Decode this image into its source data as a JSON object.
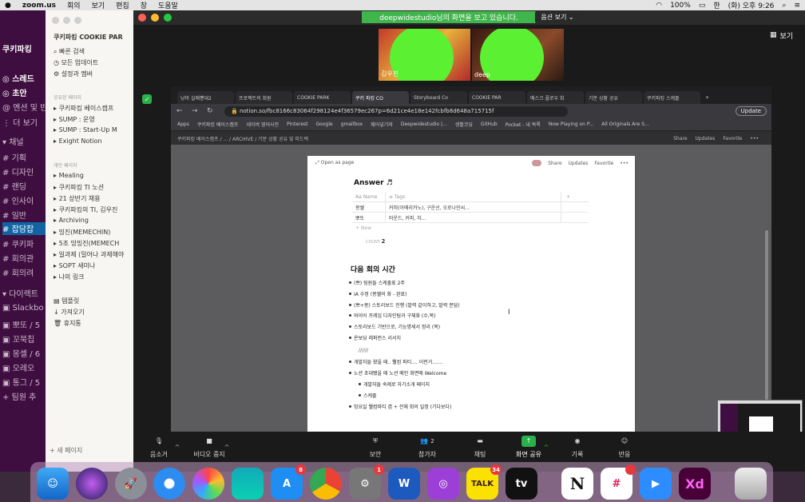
{
  "menubar": {
    "app": "zoom.us",
    "items": [
      "회의",
      "보기",
      "편집",
      "창",
      "도움말"
    ],
    "battery": "100%",
    "clock": "(화) 오후 9:26"
  },
  "slack": {
    "workspace": "쿠키파킹",
    "rows": [
      "스레드",
      "초안",
      "멘션 및 반",
      "더 보기",
      "채널",
      "기획",
      "디자인",
      "랜딩",
      "인사이",
      "일반",
      "잡담잡",
      "쿠키파",
      "회의관",
      "회의려",
      "다이렉트",
      "Slackbo",
      "뽀또 / 5",
      "꼬북칩",
      "몽셀 / 6",
      "오레오",
      "통그 / 5",
      "팀원 추"
    ]
  },
  "notion_sidebar": {
    "workspace": "쿠키파킹 COOKIE PAR",
    "quick": [
      "빠른 검색",
      "모든 업데이트",
      "설정과 멤버"
    ],
    "shared_label": "공유된 페이지",
    "shared": [
      "쿠키파킹 베이스캠프",
      "SUMP : 운영",
      "SUMP : Start-Up M",
      "Exight Notion"
    ],
    "private_label": "개인 페이지",
    "private": [
      "Mealing",
      "쿠키파킹 TI 노션",
      "21 상반기 채용",
      "쿠키파킹의 TI, 김우진",
      "Archiving",
      "밍진(MEMECHIN)",
      "5조 밍밍진(MEMECH",
      "일과제 (밀어나 과제해야",
      "SOPT 세미나",
      "나의 링크"
    ],
    "bottom": [
      "템플릿",
      "가져오기",
      "휴지통"
    ],
    "new_page": "새 페이지"
  },
  "zoom": {
    "banner": "deepwidestudio님의 화면을 보고 있습니다.",
    "view_options": "옵션 보기",
    "view_button": "보기",
    "participants": [
      {
        "name": "김우진"
      },
      {
        "name": "deep"
      }
    ],
    "toolbar": {
      "mute": "음소거",
      "video": "비디오 중지",
      "security": "보안",
      "participants": "참가자",
      "participants_count": "2",
      "chat": "채팅",
      "share": "화면 공유",
      "record": "기록",
      "reactions": "반응"
    }
  },
  "browser": {
    "tabs": [
      "낭미 실매뽕대2",
      "프로젝트의 회원",
      "COOKIE PARK",
      "쿠키 파킹 CO",
      "Storyboard Co",
      "COOKIE PAR",
      "메스크 플로우 회",
      "기분 상황 공유",
      "쿠키파킹 스케줄"
    ],
    "url": "notion.so/fbc8166c83064f298124e4f36579ec267p=6d21ce4e18e142fcbfb8d648a715715f",
    "update": "Update",
    "bookmarks": [
      "Apps",
      "쿠키파킹 베이스캠프",
      "네이버 영어사전",
      "Pinterest",
      "Google",
      "gmailbox",
      "웨어넣기와",
      "Deepwidestudio |...",
      "생활코딩",
      "GitHub",
      "Pocket - 내 목록",
      "Now Playing on P...",
      "All Originals Are S..."
    ],
    "notion_path": "쿠키파킹 베이스캠프  /  ...  /  ARCHIVE  /  기분 상황 공유 및 피드백",
    "notion_actions": [
      "Share",
      "Updates",
      "Favorite",
      "•••"
    ]
  },
  "page": {
    "open_as_page": "Open as page",
    "actions": [
      "Share",
      "Updates",
      "Favorite",
      "•••"
    ],
    "answer_heading": "Answer ♬",
    "table": {
      "headers": [
        "Aa Name",
        "≡ Tags"
      ],
      "rows": [
        [
          "몽쉘",
          "커피(아메리카노), 구운선, 오로나민씨..."
        ],
        [
          "뽀또",
          "마운드, 커피, 차..."
        ]
      ],
      "new_label": "+ New",
      "count_label": "COUNT",
      "count_value": "2"
    },
    "next_heading": "다음 회의 시간",
    "items": [
      "(쁘) 팀원들 스케줄표 2주",
      "IA 수정 (몽쉘의 화 - 완료)",
      "(쁘+몽) 스토리보드 진행 (맡력 같이하고, 맡력 분담)",
      "와이어 프레임 디자인팀과 구체화 (수,목)",
      "스토리보드 기반으로, 기능명세서 정리 (목)",
      "온보딩 레퍼런스 리서치",
      "//////",
      "개발자들 왔을 때.. 웰컴 파티.... 이런거.......",
      "노션 초대됐을 때 노션 메인 화면에 Welcome",
      "개발자들 숙제로 자기소개 페이지",
      "스케줄",
      "밍요일 웰컴파티 겸 + 전체 회의 일정 (기다보다)"
    ]
  },
  "dock": {
    "badges": {
      "appstore": "8",
      "prefs": "1",
      "kakao": "34"
    },
    "labels": [
      "W",
      "TALK",
      "tv",
      "N",
      "Xd"
    ]
  }
}
